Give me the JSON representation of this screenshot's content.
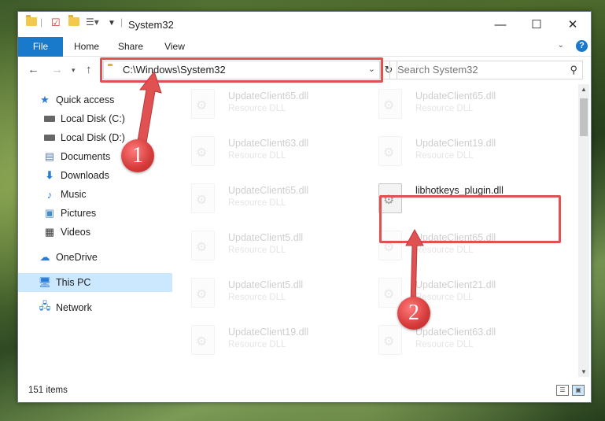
{
  "window": {
    "title": "System32",
    "controls": {
      "minimize": "—",
      "maximize": "☐",
      "close": "✕"
    },
    "help_icon": "?"
  },
  "ribbon": {
    "tabs": [
      "File",
      "Home",
      "Share",
      "View"
    ]
  },
  "nav": {
    "address": "C:\\Windows\\System32",
    "search_placeholder": "Search System32"
  },
  "sidebar": {
    "items": [
      {
        "label": "Quick access",
        "icon": "star-icon",
        "pinned": false
      },
      {
        "label": "Local Disk (C:)",
        "icon": "drive-icon",
        "pinned": true
      },
      {
        "label": "Local Disk (D:)",
        "icon": "drive-icon",
        "pinned": true
      },
      {
        "label": "Documents",
        "icon": "documents-icon",
        "pinned": true
      },
      {
        "label": "Downloads",
        "icon": "download-icon",
        "pinned": true
      },
      {
        "label": "Music",
        "icon": "music-icon",
        "pinned": true
      },
      {
        "label": "Pictures",
        "icon": "pictures-icon",
        "pinned": true
      },
      {
        "label": "Videos",
        "icon": "videos-icon",
        "pinned": true
      },
      {
        "label": "OneDrive",
        "icon": "cloud-icon",
        "pinned": false
      },
      {
        "label": "This PC",
        "icon": "computer-icon",
        "pinned": false,
        "selected": true
      },
      {
        "label": "Network",
        "icon": "network-icon",
        "pinned": false
      }
    ]
  },
  "files": [
    {
      "name": "UpdateClient65.dll",
      "type": "Resource DLL",
      "faded": true
    },
    {
      "name": "UpdateClient65.dll",
      "type": "Resource DLL",
      "faded": true
    },
    {
      "name": "UpdateClient63.dll",
      "type": "Resource DLL",
      "faded": true
    },
    {
      "name": "UpdateClient19.dll",
      "type": "Resource DLL",
      "faded": true
    },
    {
      "name": "UpdateClient65.dll",
      "type": "Resource DLL",
      "faded": true
    },
    {
      "name": "libhotkeys_plugin.dll",
      "type": "",
      "faded": false
    },
    {
      "name": "UpdateClient5.dll",
      "type": "Resource DLL",
      "faded": true
    },
    {
      "name": "UpdateClient65.dll",
      "type": "Resource DLL",
      "faded": true
    },
    {
      "name": "UpdateClient5.dll",
      "type": "Resource DLL",
      "faded": true
    },
    {
      "name": "UpdateClient21.dll",
      "type": "Resource DLL",
      "faded": true
    },
    {
      "name": "UpdateClient19.dll",
      "type": "Resource DLL",
      "faded": true
    },
    {
      "name": "UpdateClient63.dll",
      "type": "Resource DLL",
      "faded": true
    }
  ],
  "status": {
    "items_count": "151 items"
  },
  "annotations": {
    "step1": "1",
    "step2": "2",
    "color": "#e05252"
  }
}
